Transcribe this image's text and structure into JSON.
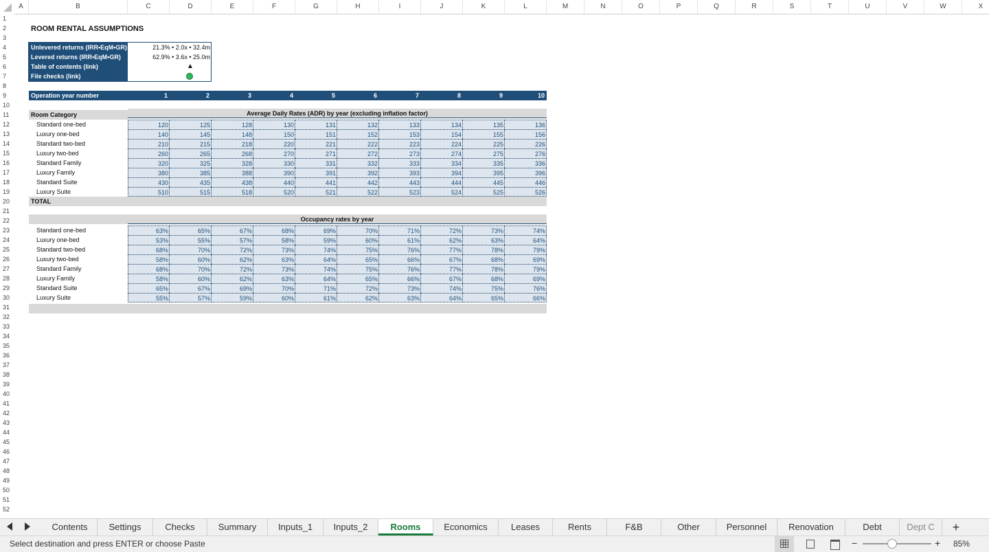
{
  "columns": [
    "A",
    "B",
    "C",
    "D",
    "E",
    "F",
    "G",
    "H",
    "I",
    "J",
    "K",
    "L",
    "M",
    "N",
    "O",
    "P",
    "Q",
    "R",
    "S",
    "T",
    "U",
    "V",
    "W",
    "X"
  ],
  "title": "ROOM RENTAL ASSUMPTIONS",
  "summary": {
    "unlevered_label": "Unlevered returns (IRR•EqM•GR)",
    "unlevered_value": "21.3% • 2.0x • 32.4m",
    "levered_label": "Levered returns (IRR•EqM•GR)",
    "levered_value": "62.9% • 3.6x • 25.0m",
    "toc_label": "Table of contents (link)",
    "toc_symbol": "▲",
    "checks_label": "File checks (link)"
  },
  "op_year_label": "Operation year number",
  "years": [
    "1",
    "2",
    "3",
    "4",
    "5",
    "6",
    "7",
    "8",
    "9",
    "10"
  ],
  "room_category_label": "Room Category",
  "adr_title": "Average Daily Rates (ADR) by year (excluding inflation factor)",
  "categories": [
    "Standard one-bed",
    "Luxury one-bed",
    "Standard two-bed",
    "Luxury two-bed",
    "Standard Family",
    "Luxury Family",
    "Standard Suite",
    "Luxury Suite"
  ],
  "adr": [
    [
      "120",
      "125",
      "128",
      "130",
      "131",
      "132",
      "133",
      "134",
      "135",
      "136"
    ],
    [
      "140",
      "145",
      "148",
      "150",
      "151",
      "152",
      "153",
      "154",
      "155",
      "156"
    ],
    [
      "210",
      "215",
      "218",
      "220",
      "221",
      "222",
      "223",
      "224",
      "225",
      "226"
    ],
    [
      "260",
      "265",
      "268",
      "270",
      "271",
      "272",
      "273",
      "274",
      "275",
      "276"
    ],
    [
      "320",
      "325",
      "328",
      "330",
      "331",
      "332",
      "333",
      "334",
      "335",
      "336"
    ],
    [
      "380",
      "385",
      "388",
      "390",
      "391",
      "392",
      "393",
      "394",
      "395",
      "396"
    ],
    [
      "430",
      "435",
      "438",
      "440",
      "441",
      "442",
      "443",
      "444",
      "445",
      "446"
    ],
    [
      "510",
      "515",
      "518",
      "520",
      "521",
      "522",
      "523",
      "524",
      "525",
      "526"
    ]
  ],
  "total_label": "TOTAL",
  "occ_title": "Occupancy rates by year",
  "occ": [
    [
      "63%",
      "65%",
      "67%",
      "68%",
      "69%",
      "70%",
      "71%",
      "72%",
      "73%",
      "74%"
    ],
    [
      "53%",
      "55%",
      "57%",
      "58%",
      "59%",
      "60%",
      "61%",
      "62%",
      "63%",
      "64%"
    ],
    [
      "68%",
      "70%",
      "72%",
      "73%",
      "74%",
      "75%",
      "76%",
      "77%",
      "78%",
      "79%"
    ],
    [
      "58%",
      "60%",
      "62%",
      "63%",
      "64%",
      "65%",
      "66%",
      "67%",
      "68%",
      "69%"
    ],
    [
      "68%",
      "70%",
      "72%",
      "73%",
      "74%",
      "75%",
      "76%",
      "77%",
      "78%",
      "79%"
    ],
    [
      "58%",
      "60%",
      "62%",
      "63%",
      "64%",
      "65%",
      "66%",
      "67%",
      "68%",
      "69%"
    ],
    [
      "65%",
      "67%",
      "69%",
      "70%",
      "71%",
      "72%",
      "73%",
      "74%",
      "75%",
      "76%"
    ],
    [
      "55%",
      "57%",
      "59%",
      "60%",
      "61%",
      "62%",
      "63%",
      "64%",
      "65%",
      "66%"
    ]
  ],
  "sheet_tabs": [
    "Contents",
    "Settings",
    "Checks",
    "Summary",
    "Inputs_1",
    "Inputs_2",
    "Rooms",
    "Economics",
    "Leases",
    "Rents",
    "F&B",
    "Other",
    "Personnel",
    "Renovation",
    "Debt",
    "Dept C"
  ],
  "active_tab": "Rooms",
  "add_sheet": "+",
  "status_text": "Select destination and press ENTER or choose Paste",
  "zoom": "85%",
  "colors": {
    "navy": "#1f4e79",
    "input_fill": "#dde6ef",
    "active_tab": "#1a7a3a",
    "check_ok": "#2eb85c"
  }
}
